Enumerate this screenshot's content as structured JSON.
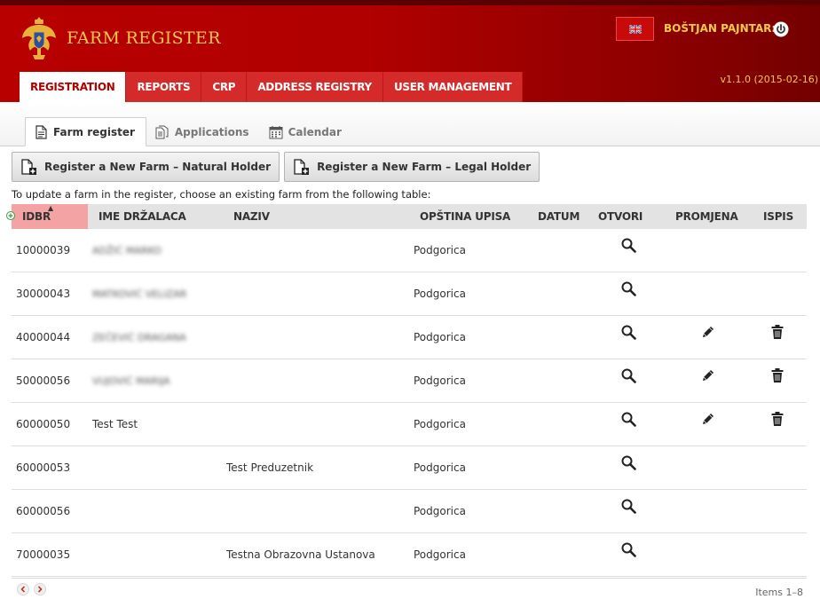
{
  "header": {
    "app_title": "FARM REGISTER",
    "user_name": "BOŠTJAN PAJNTAR:",
    "version": "v1.1.0 (2015-02-16)",
    "language_icon": "uk-flag-icon",
    "colors": {
      "brand_red": "#b00000",
      "gold": "#f7c94a",
      "nav_red": "#d42a2a"
    }
  },
  "main_nav": {
    "items": [
      {
        "label": "REGISTRATION"
      },
      {
        "label": "REPORTS"
      },
      {
        "label": "CRP"
      },
      {
        "label": "ADDRESS REGISTRY"
      },
      {
        "label": "USER MANAGEMENT"
      }
    ]
  },
  "sub_tabs": {
    "items": [
      {
        "label": "Farm register",
        "icon": "document-icon"
      },
      {
        "label": "Applications",
        "icon": "documents-icon"
      },
      {
        "label": "Calendar",
        "icon": "calendar-icon"
      }
    ]
  },
  "actions": {
    "natural_holder": "Register a New Farm – Natural Holder",
    "legal_holder": "Register a New Farm – Legal Holder"
  },
  "instructions": "To update a farm in the register, choose an existing farm from the following table:",
  "table": {
    "columns": [
      "IDBR",
      "IME DRŽALACA",
      "NAZIV",
      "OPŠTINA UPISA",
      "DATUM",
      "OTVORI",
      "PROMJENA",
      "ISPIS"
    ],
    "rows": [
      {
        "idbr": "10000039",
        "holder": "ADŽIĆ MARKO",
        "name": "",
        "municipality": "Podgorica",
        "date": ""
      },
      {
        "idbr": "30000043",
        "holder": "MATKOVIĆ VELIZAR",
        "name": "",
        "municipality": "Podgorica",
        "date": ""
      },
      {
        "idbr": "40000044",
        "holder": "ZEČEVIĆ DRAGANA",
        "name": "",
        "municipality": "Podgorica",
        "date": ""
      },
      {
        "idbr": "50000056",
        "holder": "VUJOVIĆ MARIJA",
        "name": "",
        "municipality": "Podgorica",
        "date": ""
      },
      {
        "idbr": "60000050",
        "holder": "Test Test",
        "name": "",
        "municipality": "Podgorica",
        "date": ""
      },
      {
        "idbr": "60000053",
        "holder": "",
        "name": "Test Preduzetnik",
        "municipality": "Podgorica",
        "date": ""
      },
      {
        "idbr": "60000056",
        "holder": "",
        "name": "",
        "municipality": "Podgorica",
        "date": ""
      },
      {
        "idbr": "70000035",
        "holder": "",
        "name": "Testna Obrazovna Ustanova",
        "municipality": "Podgorica",
        "date": ""
      }
    ]
  },
  "pager": {
    "items_info": "Items 1–8"
  }
}
